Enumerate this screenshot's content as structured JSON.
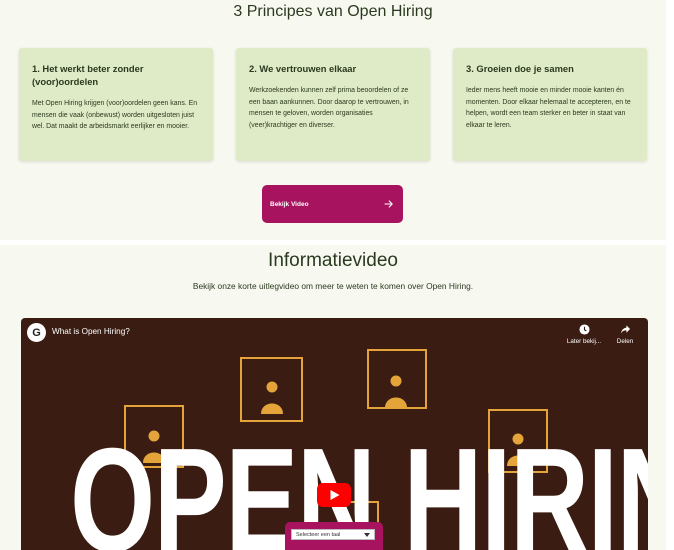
{
  "principles": {
    "title": "3 Principes van Open Hiring",
    "cards": [
      {
        "heading": "1. Het werkt beter zonder (voor)oordelen",
        "text": "Met Open Hiring krijgen (voor)oordelen geen kans. En mensen die vaak (onbewust) worden uitgesloten juist wel. Dat maakt de arbeidsmarkt eerlijker en mooier."
      },
      {
        "heading": "2. We vertrouwen elkaar",
        "text": "Werkzoekenden kunnen zelf prima beoordelen of ze een baan aankunnen. Door daarop te vertrouwen, in mensen te geloven, worden organisaties (veer)krachtiger en diverser."
      },
      {
        "heading": "3. Groeien doe je samen",
        "text": "Ieder mens heeft mooie en minder mooie kanten én momenten. Door elkaar helemaal te accepteren, en te helpen, wordt een team sterker en beter in staat van elkaar te leren."
      }
    ],
    "button_label": "Bekijk Video"
  },
  "info_video": {
    "title": "Informatievideo",
    "subtitle": "Bekijk onze korte uitlegvideo om meer te weten te komen over Open Hiring.",
    "player": {
      "channel_logo_letter": "G",
      "video_title": "What is Open Hiring?",
      "watch_later_label": "Later bekij...",
      "share_label": "Delen",
      "overlay_text": "OPEN HIRING"
    },
    "language_select": {
      "placeholder": "Selecteer een taal"
    }
  },
  "colors": {
    "accent": "#a8135f",
    "card_bg": "#dfeac7",
    "page_bg": "#f7f9f1",
    "frame": "#e5a43a",
    "video_bg": "#3a1c12"
  },
  "icons": {
    "button_arrow": "arrow-right-icon",
    "watch_later": "clock-icon",
    "share": "share-icon",
    "play": "youtube-play-icon",
    "select": "chevron-down-icon"
  }
}
